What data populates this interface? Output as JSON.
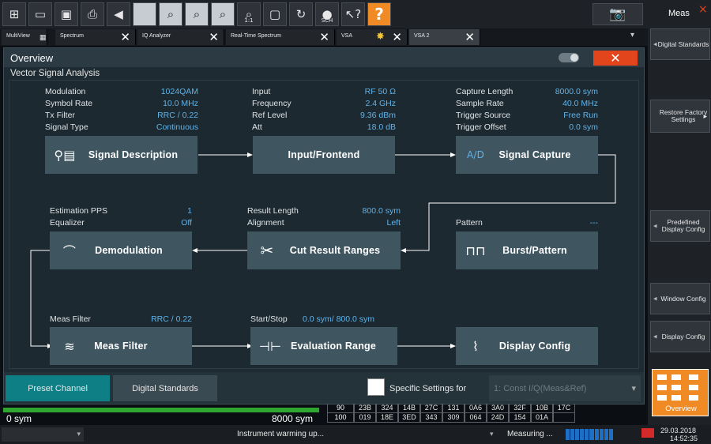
{
  "toolbar": {
    "buttons": [
      "windows-icon",
      "open-icon",
      "save-icon",
      "print-icon",
      "undo-icon",
      "blank",
      "zoom-icon",
      "multi-zoom-icon",
      "zoom-window-icon",
      "zoom-1-1-icon",
      "fullscreen-icon",
      "refresh-icon",
      "sch-icon",
      "help-pointer-icon",
      "help-icon"
    ],
    "zoom_label": "1:1",
    "sch_label": "SCH",
    "help_label": "?",
    "screenshot_label": "camera-icon"
  },
  "tabs": [
    {
      "label": "MultiView",
      "icon": "grid-icon"
    },
    {
      "label": "Spectrum"
    },
    {
      "label": "IQ Analyzer"
    },
    {
      "label": "Real-Time Spectrum"
    },
    {
      "label": "VSA",
      "icon": "star-icon"
    },
    {
      "label": "VSA 2",
      "active": true
    }
  ],
  "tab_dropdown": "▾",
  "right_panel": {
    "title": "Meas",
    "close": "×",
    "buttons": [
      "Digital Standards",
      "Restore Factory Settings",
      "Predefined Display Config",
      "Window Config",
      "Display Config"
    ],
    "overview_label": "Overview"
  },
  "dialog": {
    "title": "Overview",
    "subtitle": "Vector Signal Analysis",
    "close": "✕",
    "col1": [
      {
        "label": "Modulation",
        "value": "1024QAM"
      },
      {
        "label": "Symbol Rate",
        "value": "10.0 MHz"
      },
      {
        "label": "Tx Filter",
        "value": "RRC / 0.22"
      },
      {
        "label": "Signal Type",
        "value": "Continuous"
      }
    ],
    "col2": [
      {
        "label": "Input",
        "value": "RF 50 Ω"
      },
      {
        "label": "Frequency",
        "value": "2.4 GHz"
      },
      {
        "label": "Ref Level",
        "value": "9.36 dBm"
      },
      {
        "label": "Att",
        "value": "18.0 dB"
      }
    ],
    "col3": [
      {
        "label": "Capture Length",
        "value": "8000.0 sym"
      },
      {
        "label": "Sample Rate",
        "value": "40.0 MHz"
      },
      {
        "label": "Trigger Source",
        "value": "Free Run"
      },
      {
        "label": "Trigger Offset",
        "value": "0.0 sym"
      }
    ],
    "demod_params": [
      {
        "label": "Estimation PPS",
        "value": "1"
      },
      {
        "label": "Equalizer",
        "value": "Off"
      }
    ],
    "cut_params": [
      {
        "label": "Result Length",
        "value": "800.0 sym"
      },
      {
        "label": "Alignment",
        "value": "Left"
      }
    ],
    "pattern": {
      "label": "Pattern",
      "value": "---"
    },
    "meas_filter": {
      "label": "Meas Filter",
      "value": "RRC / 0.22"
    },
    "start_stop": {
      "label": "Start/Stop",
      "value": "0.0 sym/ 800.0 sym"
    },
    "blocks": {
      "signal_description": "Signal Description",
      "input_frontend": "Input/Frontend",
      "signal_capture": "Signal Capture",
      "signal_capture_icon": "A/D",
      "demodulation": "Demodulation",
      "cut_result_ranges": "Cut Result Ranges",
      "burst_pattern": "Burst/Pattern",
      "meas_filter": "Meas Filter",
      "evaluation_range": "Evaluation Range",
      "display_config": "Display Config"
    },
    "bottom": {
      "preset_channel": "Preset Channel",
      "digital_standards": "Digital Standards",
      "specific_settings": "Specific Settings for",
      "specific_select": "1: Const I/Q(Meas&Ref)"
    }
  },
  "status_strip": {
    "left_value": "0 sym",
    "right_value": "8000 sym",
    "table_rows": [
      [
        "90",
        "23B",
        "324",
        "14B",
        "27C",
        "131",
        "0A6",
        "3A0",
        "32F",
        "10B",
        "17C"
      ],
      [
        "100",
        "019",
        "18E",
        "3ED",
        "343",
        "309",
        "064",
        "24D",
        "154",
        "01A",
        ""
      ]
    ]
  },
  "status_bar": {
    "message": "Instrument warming up...",
    "measuring": "Measuring ...",
    "date": "29.03.2018",
    "time": "14:52:35"
  },
  "colors": {
    "accent": "#5fb3ea",
    "block": "#3f5560",
    "preset": "#0f7f86",
    "close": "#e2451b"
  }
}
